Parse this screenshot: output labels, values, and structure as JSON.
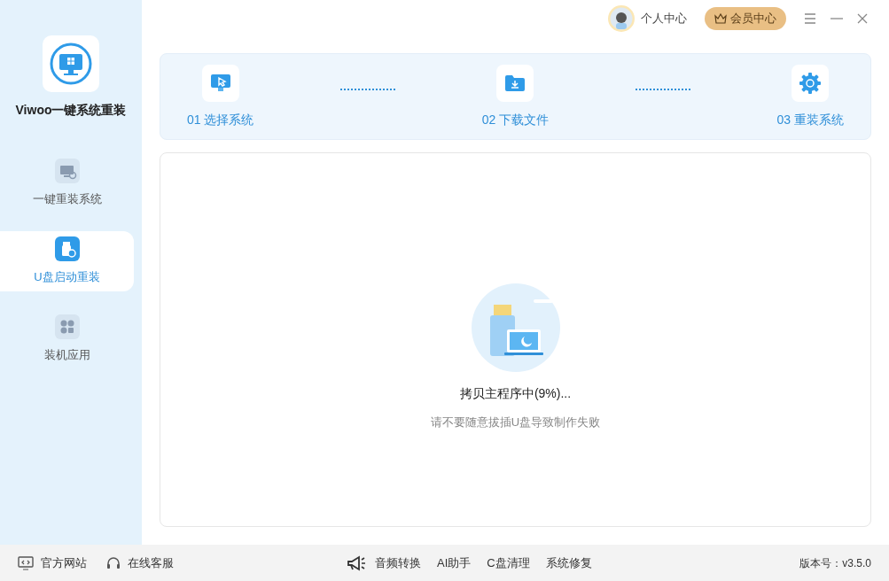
{
  "app": {
    "name": "Viwoo一键系统重装"
  },
  "sidebar": {
    "items": [
      {
        "label": "一键重装系统",
        "kind": "monitor",
        "selected": false
      },
      {
        "label": "U盘启动重装",
        "kind": "usb",
        "selected": true
      },
      {
        "label": "装机应用",
        "kind": "apps",
        "selected": false
      }
    ]
  },
  "header": {
    "profile": "个人中心",
    "vip": "会员中心"
  },
  "steps": [
    {
      "label": "01 选择系统",
      "kind": "select"
    },
    {
      "label": "02 下载文件",
      "kind": "download"
    },
    {
      "label": "03 重装系统",
      "kind": "install"
    }
  ],
  "progress": {
    "title": "拷贝主程序中(9%)...",
    "hint": "请不要随意拔插U盘导致制作失败"
  },
  "footer": {
    "left": [
      {
        "label": "官方网站",
        "kind": "web"
      },
      {
        "label": "在线客服",
        "kind": "headset"
      }
    ],
    "tools": [
      {
        "label": "音频转换",
        "kind": "megaphone"
      },
      {
        "label": "AI助手"
      },
      {
        "label": "C盘清理"
      },
      {
        "label": "系统修复"
      }
    ],
    "version": "版本号：v3.5.0"
  }
}
